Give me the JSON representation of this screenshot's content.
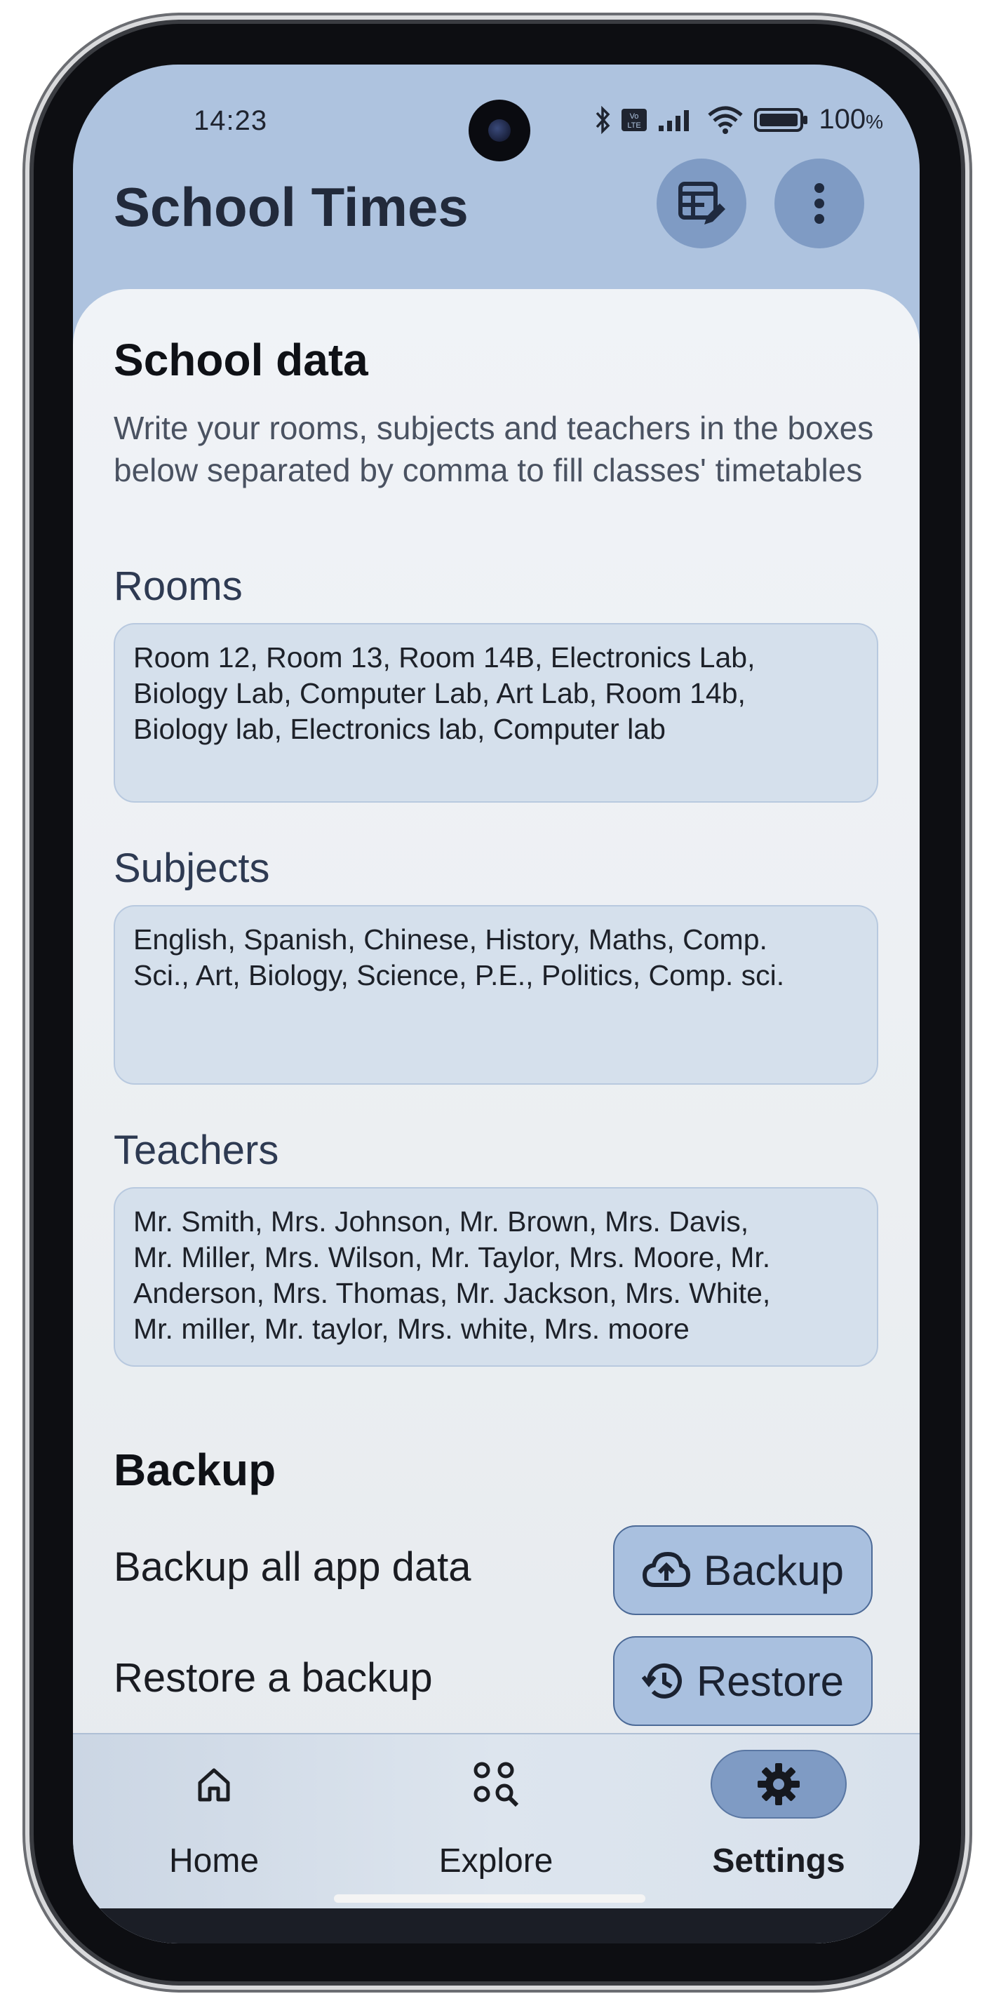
{
  "status_bar": {
    "time": "14:23",
    "battery": "100",
    "battery_unit": "%"
  },
  "app_bar": {
    "title": "School Times"
  },
  "school_data": {
    "heading": "School data",
    "description": "Write your rooms, subjects and teachers in the boxes below separated by comma to fill classes' timetables",
    "rooms": {
      "label": "Rooms",
      "value": "Room 12, Room 13, Room 14B, Electronics Lab,\nBiology Lab, Computer Lab, Art Lab, Room 14b,\nBiology lab, Electronics lab, Computer lab"
    },
    "subjects": {
      "label": "Subjects",
      "value": "English, Spanish, Chinese, History, Maths, Comp.\nSci., Art, Biology, Science, P.E., Politics, Comp. sci."
    },
    "teachers": {
      "label": "Teachers",
      "value": "Mr. Smith, Mrs. Johnson, Mr. Brown, Mrs. Davis,\nMr. Miller, Mrs. Wilson, Mr. Taylor, Mrs. Moore, Mr.\nAnderson, Mrs. Thomas, Mr. Jackson, Mrs. White,\nMr. miller, Mr. taylor, Mrs. white, Mrs. moore"
    }
  },
  "backup": {
    "heading": "Backup",
    "backup_row_text": "Backup all app data",
    "backup_button": "Backup",
    "restore_row_text": "Restore a backup",
    "restore_button": "Restore"
  },
  "nav": {
    "items": [
      {
        "label": "Home",
        "icon": "home-icon"
      },
      {
        "label": "Explore",
        "icon": "explore-icon"
      },
      {
        "label": "Settings",
        "icon": "gear-icon",
        "selected": true
      }
    ]
  },
  "colors": {
    "accent": "#7f9bc4",
    "header_bg": "#aec3df",
    "field_bg": "#d5e0ec",
    "selected_nav": "#7f9bc4"
  }
}
